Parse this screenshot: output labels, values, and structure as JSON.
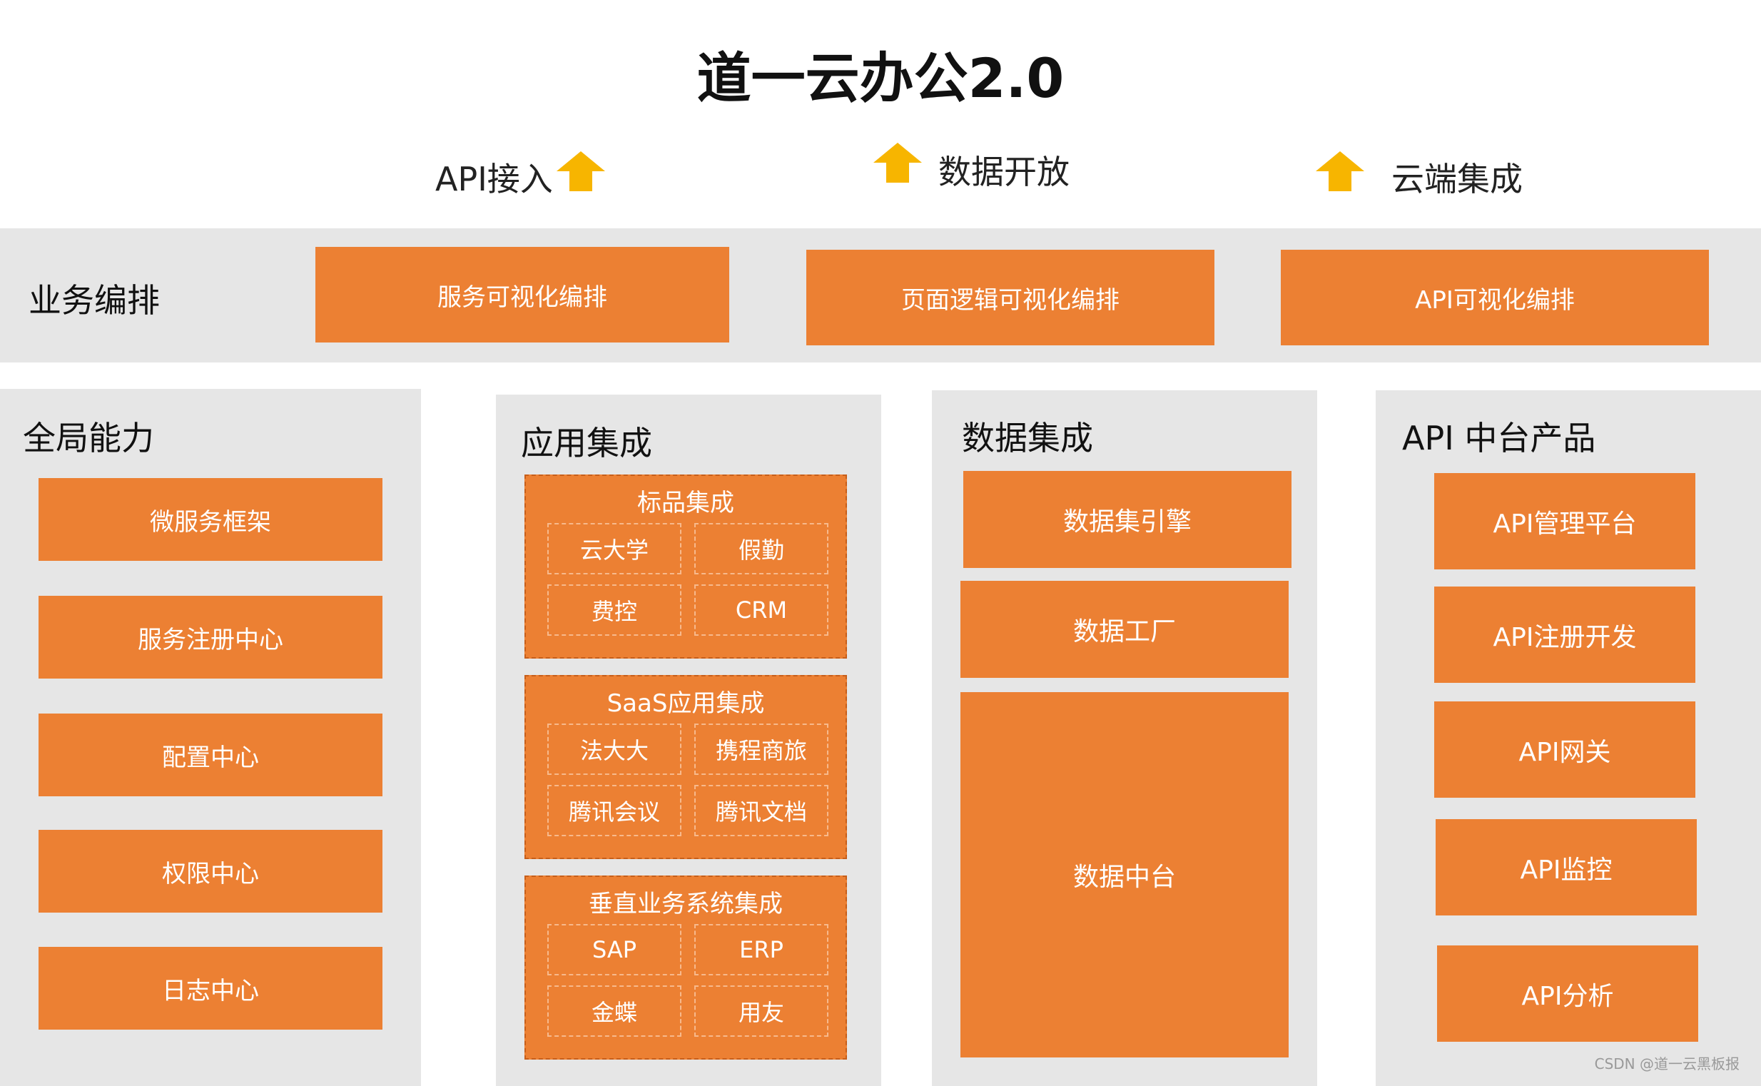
{
  "title": "道一云办公2.0",
  "top_labels": {
    "api": "API接入",
    "data": "数据开放",
    "cloud": "云端集成"
  },
  "orchestration": {
    "label": "业务编排",
    "items": [
      "服务可视化编排",
      "页面逻辑可视化编排",
      "API可视化编排"
    ]
  },
  "global": {
    "title": "全局能力",
    "items": [
      "微服务框架",
      "服务注册中心",
      "配置中心",
      "权限中心",
      "日志中心"
    ]
  },
  "app": {
    "title": "应用集成",
    "groups": [
      {
        "title": "标品集成",
        "cells": [
          "云大学",
          "假勤",
          "费控",
          "CRM"
        ]
      },
      {
        "title": "SaaS应用集成",
        "cells": [
          "法大大",
          "携程商旅",
          "腾讯会议",
          "腾讯文档"
        ]
      },
      {
        "title": "垂直业务系统集成",
        "cells": [
          "SAP",
          "ERP",
          "金蝶",
          "用友"
        ]
      }
    ]
  },
  "data_integration": {
    "title": "数据集成",
    "items": [
      "数据集引擎",
      "数据工厂",
      "数据中台"
    ]
  },
  "api_products": {
    "title": "API 中台产品",
    "items": [
      "API管理平台",
      "API注册开发",
      "API网关",
      "API监控",
      "API分析"
    ]
  },
  "watermark": "CSDN @道一云黑板报",
  "colors": {
    "orange": "#ec8033",
    "arrow": "#f7b500",
    "panel": "#e6e6e6"
  },
  "icons": {
    "arrow": "up-arrow-icon"
  }
}
